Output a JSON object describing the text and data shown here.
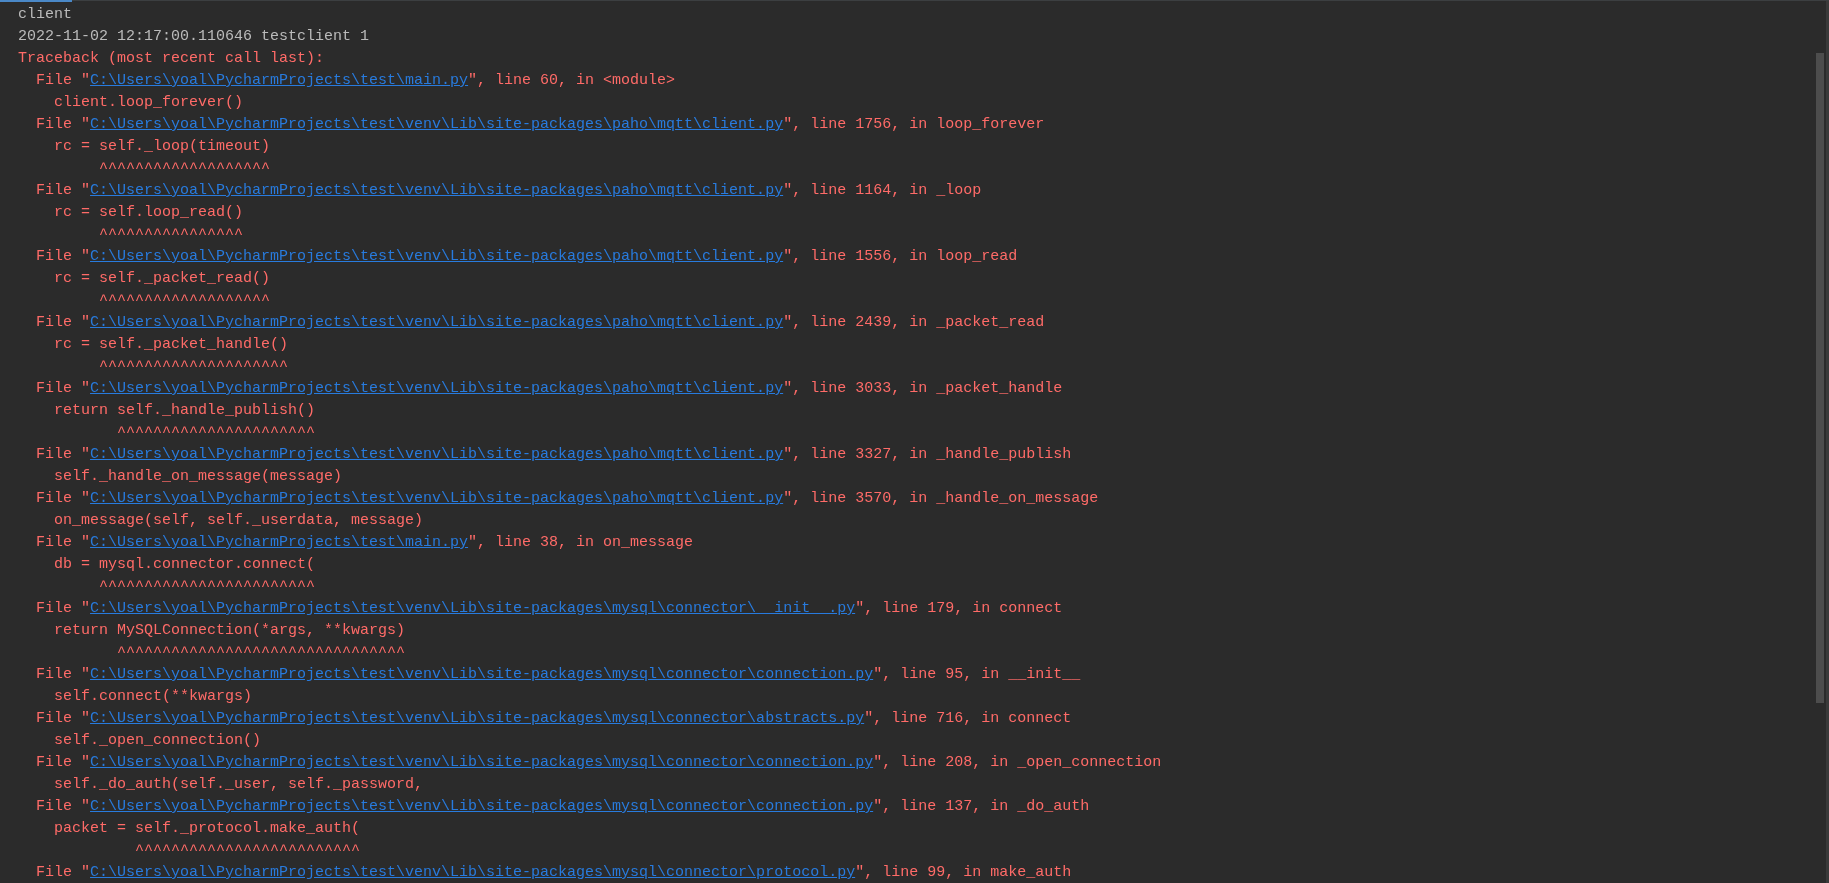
{
  "console": {
    "lines": [
      {
        "kind": "plain",
        "text": "client"
      },
      {
        "kind": "plain",
        "text": "2022-11-02 12:17:00.110646 testclient 1"
      },
      {
        "kind": "error",
        "text": "Traceback (most recent call last):"
      },
      {
        "kind": "frame",
        "prefix": "File \"",
        "path": "C:\\Users\\yoal\\PycharmProjects\\test\\main.py",
        "suffix": "\", line 60, in <module>"
      },
      {
        "kind": "code",
        "text": "client.loop_forever()"
      },
      {
        "kind": "frame",
        "prefix": "File \"",
        "path": "C:\\Users\\yoal\\PycharmProjects\\test\\venv\\Lib\\site-packages\\paho\\mqtt\\client.py",
        "suffix": "\", line 1756, in loop_forever"
      },
      {
        "kind": "code",
        "text": "rc = self._loop(timeout)"
      },
      {
        "kind": "carets",
        "text": "     ^^^^^^^^^^^^^^^^^^^"
      },
      {
        "kind": "frame",
        "prefix": "File \"",
        "path": "C:\\Users\\yoal\\PycharmProjects\\test\\venv\\Lib\\site-packages\\paho\\mqtt\\client.py",
        "suffix": "\", line 1164, in _loop"
      },
      {
        "kind": "code",
        "text": "rc = self.loop_read()"
      },
      {
        "kind": "carets",
        "text": "     ^^^^^^^^^^^^^^^^"
      },
      {
        "kind": "frame",
        "prefix": "File \"",
        "path": "C:\\Users\\yoal\\PycharmProjects\\test\\venv\\Lib\\site-packages\\paho\\mqtt\\client.py",
        "suffix": "\", line 1556, in loop_read"
      },
      {
        "kind": "code",
        "text": "rc = self._packet_read()"
      },
      {
        "kind": "carets",
        "text": "     ^^^^^^^^^^^^^^^^^^^"
      },
      {
        "kind": "frame",
        "prefix": "File \"",
        "path": "C:\\Users\\yoal\\PycharmProjects\\test\\venv\\Lib\\site-packages\\paho\\mqtt\\client.py",
        "suffix": "\", line 2439, in _packet_read"
      },
      {
        "kind": "code",
        "text": "rc = self._packet_handle()"
      },
      {
        "kind": "carets",
        "text": "     ^^^^^^^^^^^^^^^^^^^^^"
      },
      {
        "kind": "frame",
        "prefix": "File \"",
        "path": "C:\\Users\\yoal\\PycharmProjects\\test\\venv\\Lib\\site-packages\\paho\\mqtt\\client.py",
        "suffix": "\", line 3033, in _packet_handle"
      },
      {
        "kind": "code",
        "text": "return self._handle_publish()"
      },
      {
        "kind": "carets",
        "text": "       ^^^^^^^^^^^^^^^^^^^^^^"
      },
      {
        "kind": "frame",
        "prefix": "File \"",
        "path": "C:\\Users\\yoal\\PycharmProjects\\test\\venv\\Lib\\site-packages\\paho\\mqtt\\client.py",
        "suffix": "\", line 3327, in _handle_publish"
      },
      {
        "kind": "code",
        "text": "self._handle_on_message(message)"
      },
      {
        "kind": "frame",
        "prefix": "File \"",
        "path": "C:\\Users\\yoal\\PycharmProjects\\test\\venv\\Lib\\site-packages\\paho\\mqtt\\client.py",
        "suffix": "\", line 3570, in _handle_on_message"
      },
      {
        "kind": "code",
        "text": "on_message(self, self._userdata, message)"
      },
      {
        "kind": "frame",
        "prefix": "File \"",
        "path": "C:\\Users\\yoal\\PycharmProjects\\test\\main.py",
        "suffix": "\", line 38, in on_message"
      },
      {
        "kind": "code",
        "text": "db = mysql.connector.connect("
      },
      {
        "kind": "carets",
        "text": "     ^^^^^^^^^^^^^^^^^^^^^^^^"
      },
      {
        "kind": "frame",
        "prefix": "File \"",
        "path": "C:\\Users\\yoal\\PycharmProjects\\test\\venv\\Lib\\site-packages\\mysql\\connector\\__init__.py",
        "suffix": "\", line 179, in connect"
      },
      {
        "kind": "code",
        "text": "return MySQLConnection(*args, **kwargs)"
      },
      {
        "kind": "carets",
        "text": "       ^^^^^^^^^^^^^^^^^^^^^^^^^^^^^^^^"
      },
      {
        "kind": "frame",
        "prefix": "File \"",
        "path": "C:\\Users\\yoal\\PycharmProjects\\test\\venv\\Lib\\site-packages\\mysql\\connector\\connection.py",
        "suffix": "\", line 95, in __init__"
      },
      {
        "kind": "code",
        "text": "self.connect(**kwargs)"
      },
      {
        "kind": "frame",
        "prefix": "File \"",
        "path": "C:\\Users\\yoal\\PycharmProjects\\test\\venv\\Lib\\site-packages\\mysql\\connector\\abstracts.py",
        "suffix": "\", line 716, in connect"
      },
      {
        "kind": "code",
        "text": "self._open_connection()"
      },
      {
        "kind": "frame",
        "prefix": "File \"",
        "path": "C:\\Users\\yoal\\PycharmProjects\\test\\venv\\Lib\\site-packages\\mysql\\connector\\connection.py",
        "suffix": "\", line 208, in _open_connection"
      },
      {
        "kind": "code",
        "text": "self._do_auth(self._user, self._password,"
      },
      {
        "kind": "frame",
        "prefix": "File \"",
        "path": "C:\\Users\\yoal\\PycharmProjects\\test\\venv\\Lib\\site-packages\\mysql\\connector\\connection.py",
        "suffix": "\", line 137, in _do_auth"
      },
      {
        "kind": "code",
        "text": "packet = self._protocol.make_auth("
      },
      {
        "kind": "carets",
        "text": "         ^^^^^^^^^^^^^^^^^^^^^^^^^"
      },
      {
        "kind": "frame",
        "prefix": "File \"",
        "path": "C:\\Users\\yoal\\PycharmProjects\\test\\venv\\Lib\\site-packages\\mysql\\connector\\protocol.py",
        "suffix": "\", line 99, in make_auth"
      }
    ]
  }
}
